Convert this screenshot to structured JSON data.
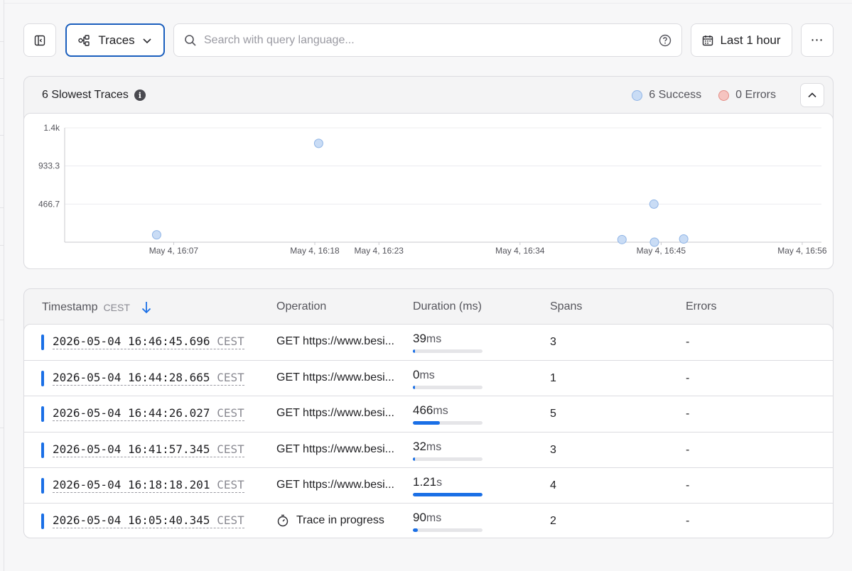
{
  "toolbar": {
    "sidebar_icon": "sidebar-toggle-icon",
    "view_label": "Traces",
    "view_icon": "traces-icon",
    "search_placeholder": "Search with query language...",
    "time_range_label": "Last 1 hour",
    "more_label": "⋯"
  },
  "chart_panel": {
    "title": "6 Slowest Traces",
    "legend": [
      {
        "label": "6 Success",
        "color": "#c9dcf5",
        "border": "#8fb4e6"
      },
      {
        "label": "0 Errors",
        "color": "#f6c4c0",
        "border": "#e38d86"
      }
    ]
  },
  "chart_data": {
    "type": "scatter",
    "title": "6 Slowest Traces",
    "xlabel": "",
    "ylabel": "",
    "y_ticks": [
      "1.4k",
      "933.3",
      "466.7"
    ],
    "y_tick_values": [
      1400,
      933.3,
      466.7
    ],
    "ylim": [
      0,
      1400
    ],
    "x_ticks": [
      "May 4, 16:07",
      "May 4, 16:18",
      "May 4, 16:23",
      "May 4, 16:34",
      "May 4, 16:45",
      "May 4, 16:56"
    ],
    "x_tick_minutes": [
      967,
      978,
      983,
      994,
      1005,
      1016
    ],
    "xlim_minutes": [
      958.5,
      1017.5
    ],
    "grid": true,
    "series": [
      {
        "name": "Success",
        "color": "#c9dcf5",
        "points": [
          {
            "x": "16:05:40",
            "x_min": 965.67,
            "y": 90
          },
          {
            "x": "16:18:18",
            "x_min": 978.3,
            "y": 1210
          },
          {
            "x": "16:41:57",
            "x_min": 1001.95,
            "y": 32
          },
          {
            "x": "16:44:26",
            "x_min": 1004.44,
            "y": 466
          },
          {
            "x": "16:44:28",
            "x_min": 1004.48,
            "y": 0
          },
          {
            "x": "16:46:45",
            "x_min": 1006.76,
            "y": 39
          }
        ]
      }
    ]
  },
  "table": {
    "columns": {
      "timestamp": "Timestamp",
      "timestamp_unit": "CEST",
      "operation": "Operation",
      "duration": "Duration (ms)",
      "spans": "Spans",
      "errors": "Errors"
    },
    "rows": [
      {
        "timestamp": "2026-05-04 16:46:45.696",
        "tz": "CEST",
        "operation": "GET https://www.besi...",
        "in_progress": false,
        "dur_value": "39",
        "dur_unit": "ms",
        "dur_fraction": 0.032,
        "spans": "3",
        "errors": "-"
      },
      {
        "timestamp": "2026-05-04 16:44:28.665",
        "tz": "CEST",
        "operation": "GET https://www.besi...",
        "in_progress": false,
        "dur_value": "0",
        "dur_unit": "ms",
        "dur_fraction": 0.0,
        "spans": "1",
        "errors": "-"
      },
      {
        "timestamp": "2026-05-04 16:44:26.027",
        "tz": "CEST",
        "operation": "GET https://www.besi...",
        "in_progress": false,
        "dur_value": "466",
        "dur_unit": "ms",
        "dur_fraction": 0.385,
        "spans": "5",
        "errors": "-"
      },
      {
        "timestamp": "2026-05-04 16:41:57.345",
        "tz": "CEST",
        "operation": "GET https://www.besi...",
        "in_progress": false,
        "dur_value": "32",
        "dur_unit": "ms",
        "dur_fraction": 0.026,
        "spans": "3",
        "errors": "-"
      },
      {
        "timestamp": "2026-05-04 16:18:18.201",
        "tz": "CEST",
        "operation": "GET https://www.besi...",
        "in_progress": false,
        "dur_value": "1.21",
        "dur_unit": "s",
        "dur_fraction": 1.0,
        "spans": "4",
        "errors": "-"
      },
      {
        "timestamp": "2026-05-04 16:05:40.345",
        "tz": "CEST",
        "operation": "Trace in progress",
        "in_progress": true,
        "dur_value": "90",
        "dur_unit": "ms",
        "dur_fraction": 0.074,
        "spans": "2",
        "errors": "-"
      }
    ]
  }
}
